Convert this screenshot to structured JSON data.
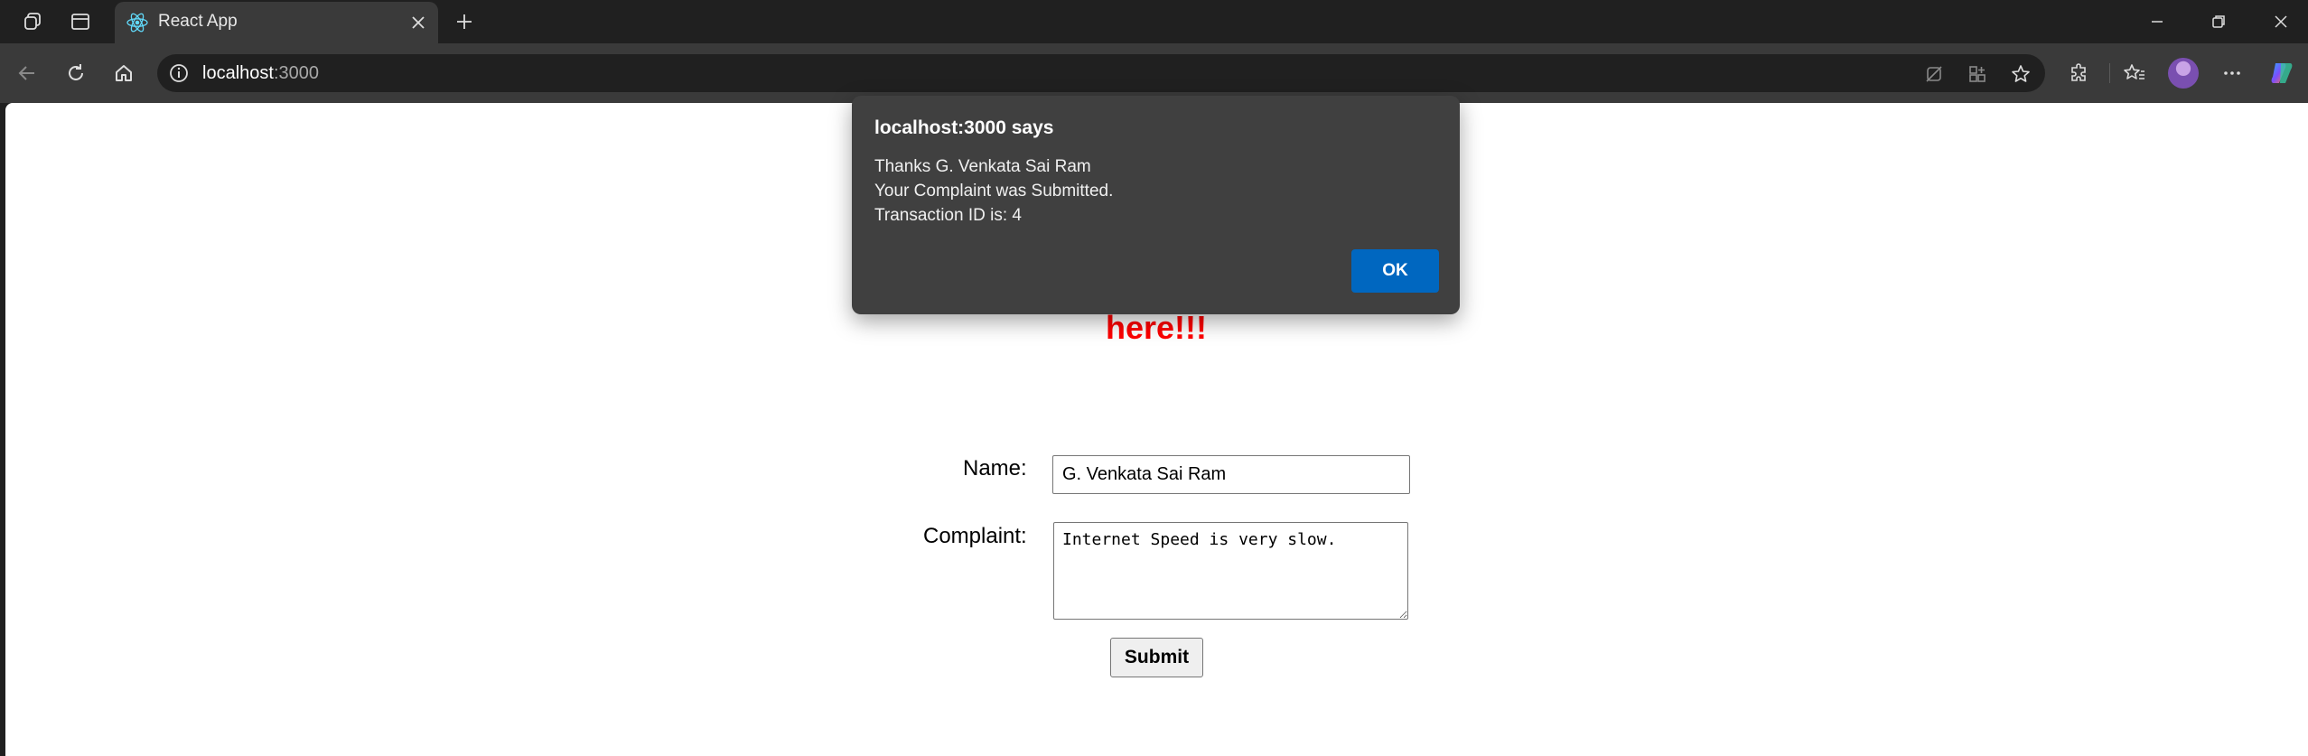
{
  "browser": {
    "tab_title": "React App",
    "url_host": "localhost",
    "url_port": ":3000"
  },
  "page": {
    "heading": "Register your complaints here!!!",
    "name_label": "Name:",
    "name_value": "G. Venkata Sai Ram",
    "complaint_label": "Complaint:",
    "complaint_value": "Internet Speed is very slow.",
    "submit_label": "Submit",
    "heading_color": "#ff0000"
  },
  "dialog": {
    "title": "localhost:3000 says",
    "line1": "Thanks G. Venkata Sai Ram",
    "line2": "Your Complaint was Submitted.",
    "line3": "Transaction ID is: 4",
    "ok_label": "OK",
    "ok_color": "#0067c0"
  }
}
